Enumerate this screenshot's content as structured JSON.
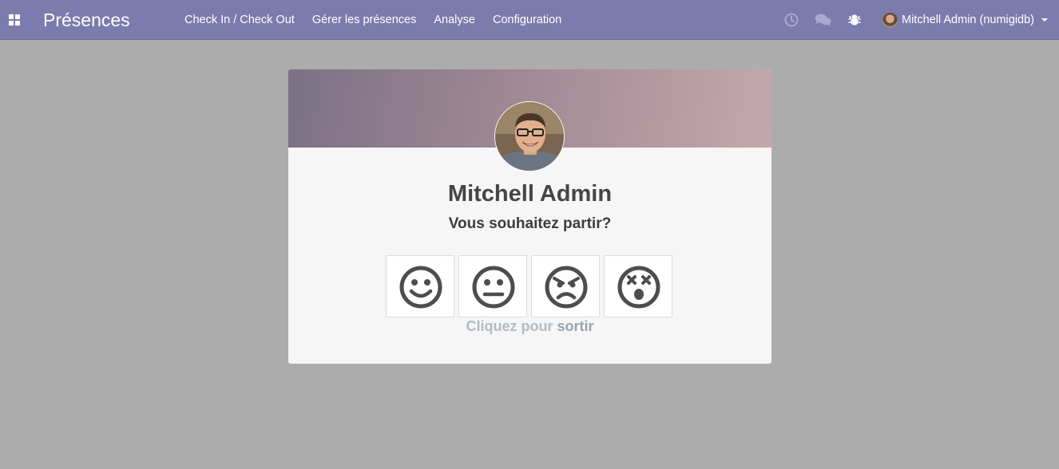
{
  "app": {
    "title": "Présences"
  },
  "menu": {
    "items": [
      "Check In / Check Out",
      "Gérer les présences",
      "Analyse",
      "Configuration"
    ]
  },
  "user": {
    "name": "Mitchell Admin (numigidb)"
  },
  "icons": {
    "apps": "apps-grid-icon",
    "activity": "clock-icon",
    "messaging": "chat-icon",
    "debug": "bug-icon"
  },
  "employee": {
    "name": "Mitchell Admin"
  },
  "prompt": "Vous souhaitez partir?",
  "moods": [
    "happy",
    "neutral",
    "angry",
    "dizzy"
  ],
  "hint": {
    "prefix": "Cliquez pour ",
    "action": "sortir"
  },
  "colors": {
    "navbar": "#7c7bad",
    "background": "#acacac",
    "card": "#f6f6f6"
  }
}
